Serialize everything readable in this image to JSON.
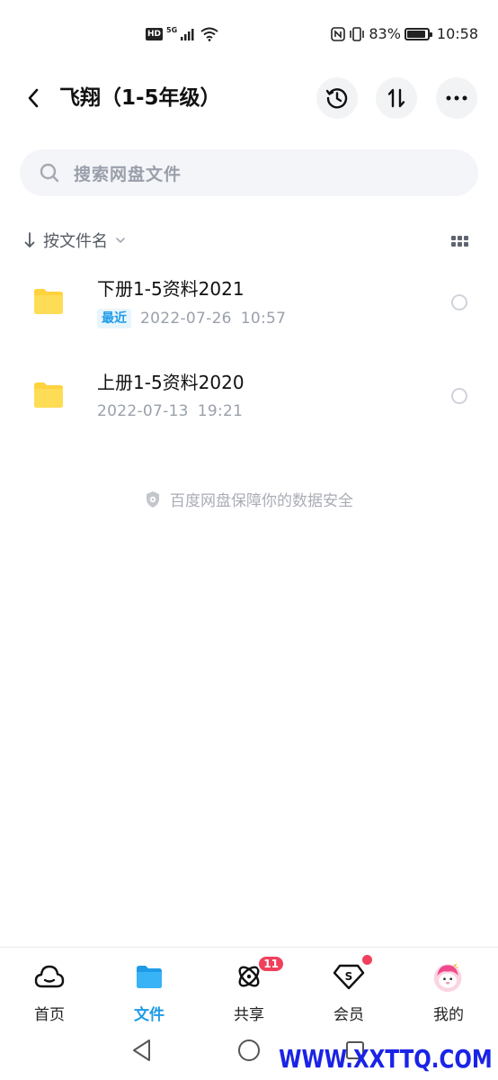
{
  "status_bar": {
    "hd": "HD",
    "network": "5G",
    "battery_text": "83%",
    "battery_level": 0.83,
    "time": "10:58"
  },
  "header": {
    "title": "飞翔（1-5年级）",
    "icons": [
      "back-icon",
      "history-icon",
      "sort-icon",
      "more-icon"
    ]
  },
  "search": {
    "placeholder": "搜索网盘文件"
  },
  "sort": {
    "label": "按文件名"
  },
  "files": [
    {
      "name": "下册1-5资料2021",
      "badge": "最近",
      "date": "2022-07-26",
      "time": "10:57"
    },
    {
      "name": "上册1-5资料2020",
      "badge": "",
      "date": "2022-07-13",
      "time": "19:21"
    }
  ],
  "safety_note": "百度网盘保障你的数据安全",
  "tabs": [
    {
      "label": "首页",
      "icon": "cloud-home-icon",
      "active": false
    },
    {
      "label": "文件",
      "icon": "folder-icon",
      "active": true
    },
    {
      "label": "共享",
      "icon": "orbit-share-icon",
      "badge": "11"
    },
    {
      "label": "会员",
      "icon": "vip-diamond-icon",
      "dot": true
    },
    {
      "label": "我的",
      "icon": "avatar-icon"
    }
  ],
  "watermark": "WWW.XXTTQ.COM",
  "colors": {
    "accent": "#1e9be8",
    "folder": "#ffd23f",
    "badge_red": "#f0405b"
  }
}
